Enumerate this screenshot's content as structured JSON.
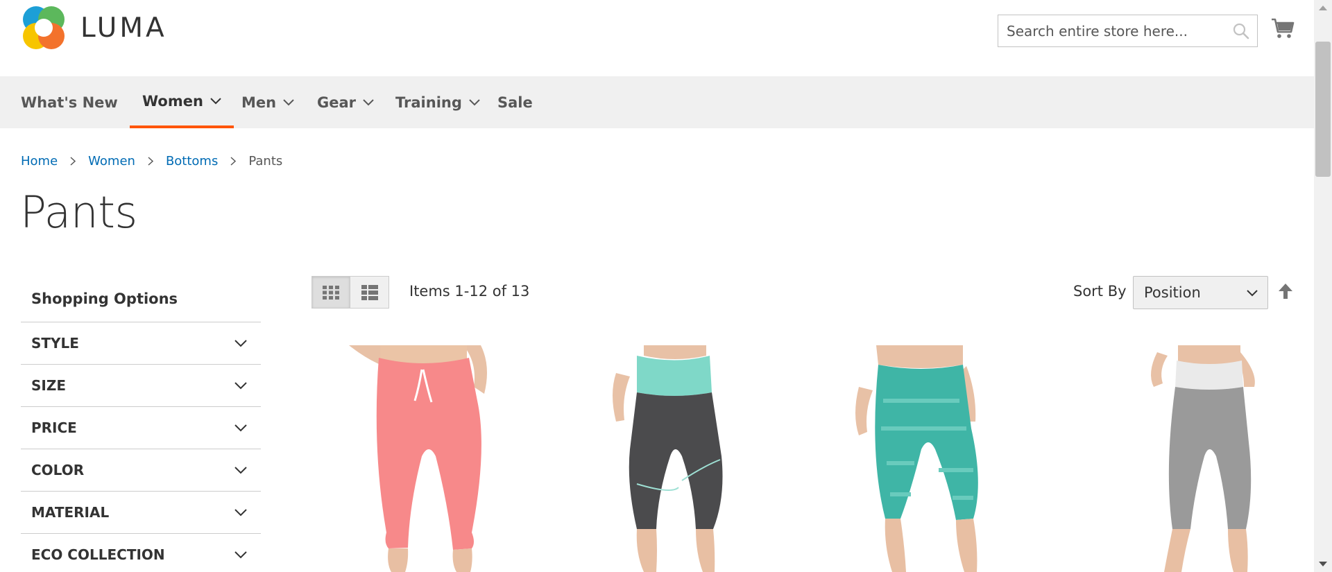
{
  "header": {
    "logo_text": "LUMA",
    "search_placeholder": "Search entire store here...",
    "search_icon": "search-icon",
    "cart_icon": "shopping-cart-icon"
  },
  "nav": {
    "items": [
      {
        "label": "What's New",
        "has_dropdown": false
      },
      {
        "label": "Women",
        "has_dropdown": true,
        "active": true
      },
      {
        "label": "Men",
        "has_dropdown": true
      },
      {
        "label": "Gear",
        "has_dropdown": true
      },
      {
        "label": "Training",
        "has_dropdown": true
      },
      {
        "label": "Sale",
        "has_dropdown": false
      }
    ],
    "active_color": "#ff5501"
  },
  "breadcrumb": {
    "items": [
      "Home",
      "Women",
      "Bottoms"
    ],
    "current": "Pants"
  },
  "page_title": "Pants",
  "sidebar": {
    "title": "Shopping Options",
    "filters": [
      "STYLE",
      "SIZE",
      "PRICE",
      "COLOR",
      "MATERIAL",
      "ECO COLLECTION"
    ]
  },
  "toolbar": {
    "grid_icon": "grid-view-icon",
    "list_icon": "list-view-icon",
    "amount": "Items 1-12 of 13",
    "sort_label": "Sort By",
    "sort_value": "Position",
    "sort_dir_icon": "sort-ascending-arrow-icon"
  },
  "products": [
    {
      "image": "pink-capri-sweatpants-image",
      "colors": [
        "#f7898a"
      ]
    },
    {
      "image": "charcoal-capri-leggings-mint-waistband-image",
      "colors": [
        "#4b4b4d",
        "#7fd8c8"
      ]
    },
    {
      "image": "teal-patterned-capri-leggings-image",
      "colors": [
        "#3fb5a6"
      ]
    },
    {
      "image": "grey-capri-leggings-white-waistband-image",
      "colors": [
        "#9a9a9a",
        "#eaeaea"
      ]
    }
  ]
}
